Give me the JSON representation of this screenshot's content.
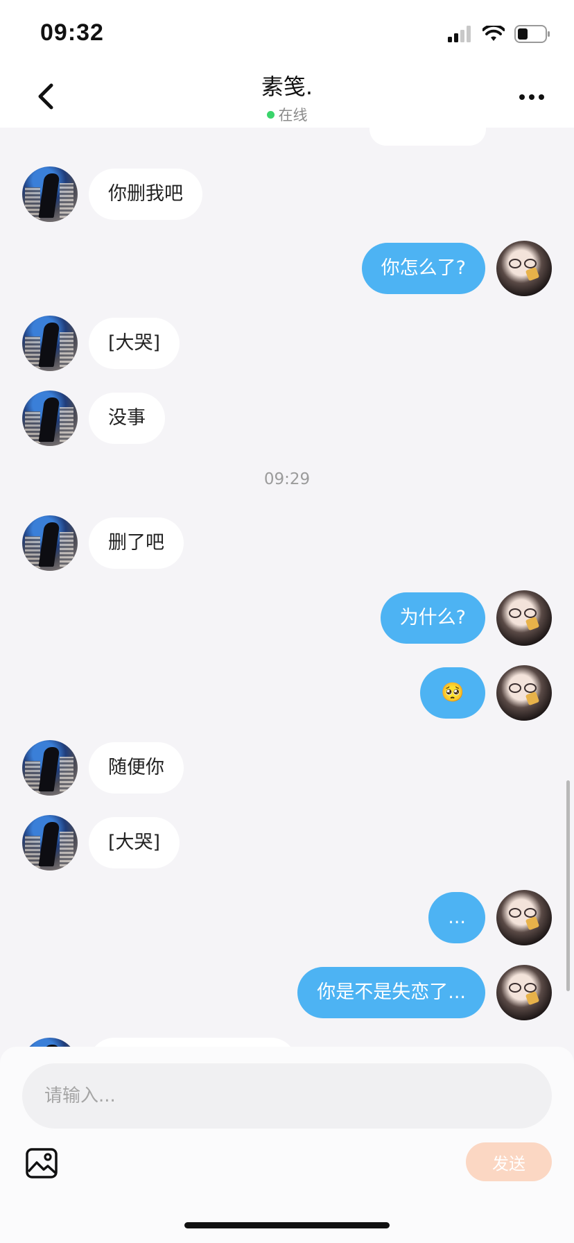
{
  "status_bar": {
    "time": "09:32"
  },
  "header": {
    "title": "素笺.",
    "status": "在线"
  },
  "messages": [
    {
      "side": "left",
      "text": "你删我吧"
    },
    {
      "side": "right",
      "text": "你怎么了?"
    },
    {
      "side": "left",
      "text": "[大哭]"
    },
    {
      "side": "left",
      "text": "没事"
    },
    {
      "side": "left",
      "text": "删了吧"
    },
    {
      "side": "right",
      "text": "为什么?"
    },
    {
      "side": "right",
      "text": "🥺"
    },
    {
      "side": "left",
      "text": "随便你"
    },
    {
      "side": "left",
      "text": "[大哭]"
    },
    {
      "side": "right",
      "text": "..."
    },
    {
      "side": "right",
      "text": "你是不是失恋了..."
    }
  ],
  "time_divider": "09:29",
  "composer": {
    "placeholder": "请输入...",
    "send_label": "发送"
  },
  "icons": {
    "back": "chevron-left-icon",
    "more": "more-dots-icon",
    "image": "image-icon",
    "wifi": "wifi-icon",
    "signal": "signal-icon",
    "battery": "battery-icon"
  },
  "colors": {
    "outgoing_bubble": "#4db3f3",
    "incoming_bubble": "#ffffff",
    "online": "#3ad46b",
    "send_button": "#fbd7c3"
  }
}
